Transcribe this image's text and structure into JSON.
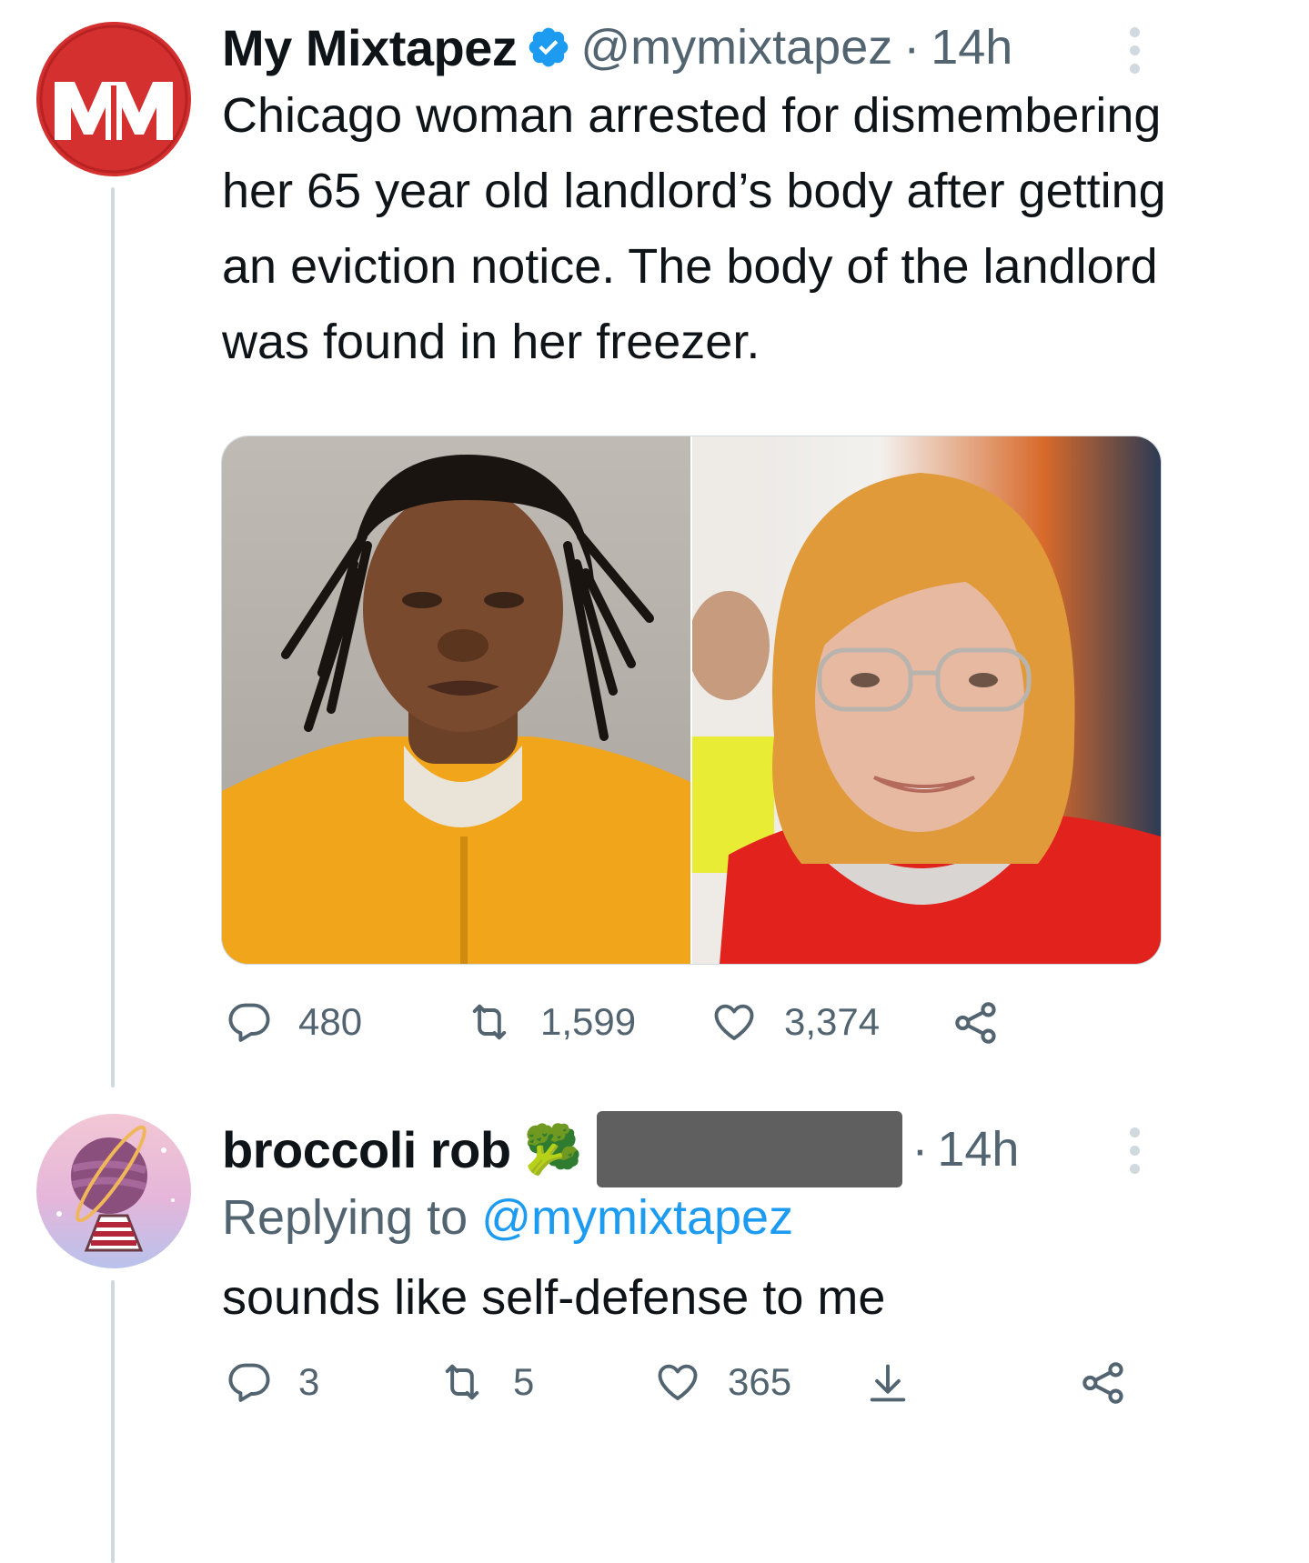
{
  "tweet": {
    "display_name": "My Mixtapez",
    "handle": "@mymixtapez",
    "separator": "·",
    "time": "14h",
    "avatar_text": "MM",
    "text": "Chicago woman arrested for dismembering her 65 year old landlord’s body after getting an eviction notice. The body of the landlord was found in her freezer.",
    "replies": "480",
    "retweets": "1,599",
    "likes": "3,374",
    "verified": true
  },
  "reply": {
    "display_name": "broccoli rob",
    "name_emoji": "🥦",
    "separator": "·",
    "time": "14h",
    "replying_prefix": "Replying to",
    "replying_handle": "@mymixtapez",
    "text": "sounds like self-defense to me",
    "replies": "3",
    "retweets": "5",
    "likes": "365"
  },
  "colors": {
    "accent": "#1d9bf0",
    "brand_red": "#d62f2f",
    "muted": "#536471",
    "line": "#cfd9de"
  }
}
